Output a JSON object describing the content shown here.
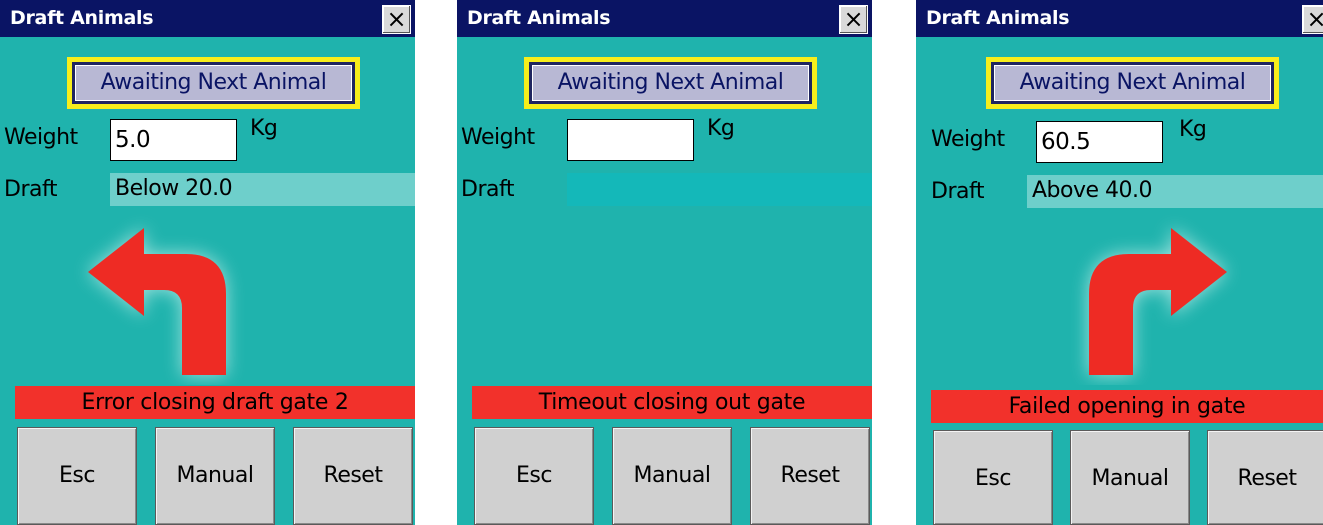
{
  "colors": {
    "titlebar": "#0a1464",
    "panel_bg": "#1fb3ad",
    "status_border": "#f7ee1c",
    "error_bar": "#f2312b",
    "arrow": "#ee2b24",
    "button_bg": "#d0d0d0"
  },
  "screens": [
    {
      "title": "Draft Animals",
      "close_icon": "×",
      "status": "Awaiting Next Animal",
      "weight_label": "Weight",
      "weight_value": "5.0",
      "unit": "Kg",
      "draft_label": "Draft",
      "draft_value": "Below 20.0",
      "arrow": "left-turn-arrow-icon",
      "error": "Error closing draft gate 2",
      "buttons": {
        "esc": "Esc",
        "manual": "Manual",
        "reset": "Reset"
      }
    },
    {
      "title": "Draft Animals",
      "close_icon": "×",
      "status": "Awaiting Next Animal",
      "weight_label": "Weight",
      "weight_value": "",
      "unit": "Kg",
      "draft_label": "Draft",
      "draft_value": "",
      "arrow": "",
      "error": "Timeout closing out gate",
      "buttons": {
        "esc": "Esc",
        "manual": "Manual",
        "reset": "Reset"
      }
    },
    {
      "title": "Draft Animals",
      "close_icon": "×",
      "status": "Awaiting Next Animal",
      "weight_label": "Weight",
      "weight_value": "60.5",
      "unit": "Kg",
      "draft_label": "Draft",
      "draft_value": "Above 40.0",
      "arrow": "right-turn-arrow-icon",
      "error": "Failed opening in gate",
      "buttons": {
        "esc": "Esc",
        "manual": "Manual",
        "reset": "Reset"
      }
    }
  ]
}
